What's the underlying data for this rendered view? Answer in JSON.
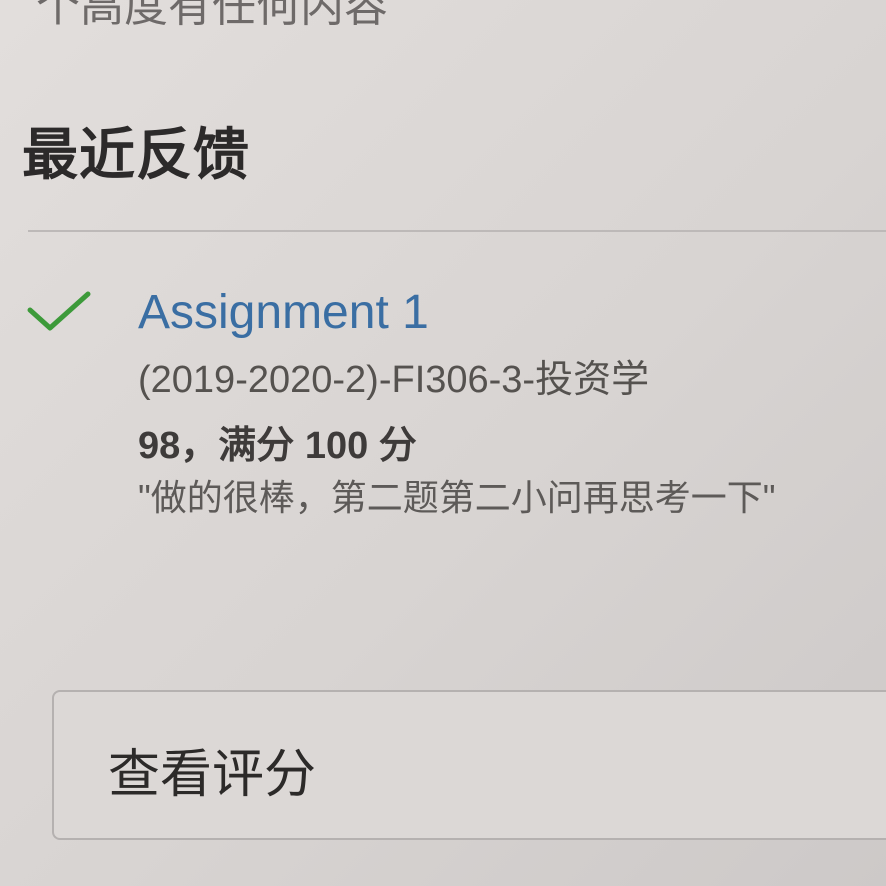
{
  "top_text_partial": "个高度有任何内容",
  "section": {
    "title": "最近反馈"
  },
  "feedback": {
    "status_icon": "check-icon",
    "status_color": "#3d9a3a",
    "assignment_title": "Assignment 1",
    "course": "(2019-2020-2)-FI306-3-投资学",
    "score_text": "98，满分 100 分",
    "comment": "\"做的很棒，第二题第二小问再思考一下\""
  },
  "actions": {
    "view_grades_label": "查看评分"
  },
  "colors": {
    "link": "#3a6ea3",
    "background": "#d9d5d3"
  }
}
